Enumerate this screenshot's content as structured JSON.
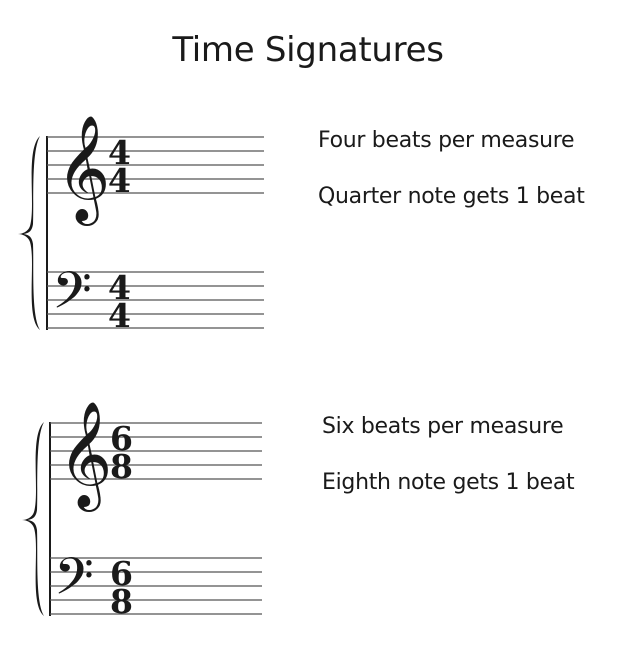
{
  "title": "Time Signatures",
  "examples": [
    {
      "treble": {
        "clef": "treble-clef",
        "numerator": "4",
        "denominator": "4"
      },
      "bass": {
        "clef": "bass-clef",
        "numerator": "4",
        "denominator": "4"
      },
      "descriptions": [
        "Four beats per measure",
        "Quarter note gets 1 beat"
      ]
    },
    {
      "treble": {
        "clef": "treble-clef",
        "numerator": "6",
        "denominator": "8"
      },
      "bass": {
        "clef": "bass-clef",
        "numerator": "6",
        "denominator": "8"
      },
      "descriptions": [
        "Six beats per measure",
        "Eighth note gets 1 beat"
      ]
    }
  ]
}
